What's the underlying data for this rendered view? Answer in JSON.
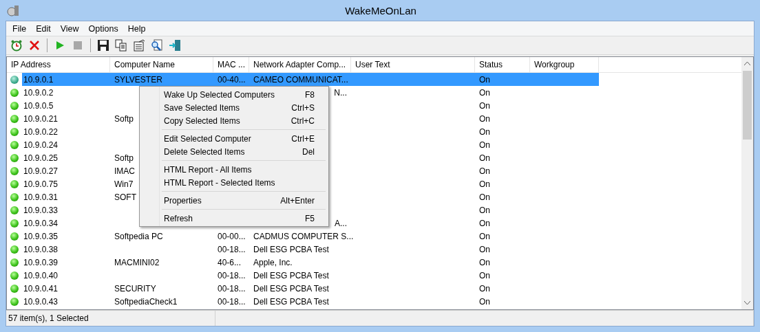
{
  "window": {
    "title": "WakeMeOnLan"
  },
  "menu_bar": [
    "File",
    "Edit",
    "View",
    "Options",
    "Help"
  ],
  "toolbar": [
    {
      "kind": "alarm"
    },
    {
      "kind": "delete"
    },
    {
      "kind": "separator"
    },
    {
      "kind": "play"
    },
    {
      "kind": "stop",
      "disabled": true
    },
    {
      "kind": "separator"
    },
    {
      "kind": "save"
    },
    {
      "kind": "copy"
    },
    {
      "kind": "properties"
    },
    {
      "kind": "find"
    },
    {
      "kind": "exit"
    }
  ],
  "table": {
    "columns": [
      "IP Address",
      "Computer Name",
      "MAC ...",
      "Network Adapter Comp...",
      "User Text",
      "Status",
      "Workgroup"
    ],
    "rows": [
      {
        "ip": "10.9.0.1",
        "computer": "SYLVESTER",
        "mac": "00-40...",
        "adapter": "CAMEO COMMUNICAT...",
        "status": "On",
        "selected": true
      },
      {
        "ip": "10.9.0.2",
        "adapter": "N...",
        "status": "On",
        "selected": false,
        "covered": true
      },
      {
        "ip": "10.9.0.5",
        "status": "On",
        "selected": false
      },
      {
        "ip": "10.9.0.21",
        "computer": "Softp",
        "status": "On",
        "selected": false
      },
      {
        "ip": "10.9.0.22",
        "status": "On",
        "selected": false
      },
      {
        "ip": "10.9.0.24",
        "status": "On",
        "selected": false
      },
      {
        "ip": "10.9.0.25",
        "computer": "Softp",
        "status": "On",
        "selected": false
      },
      {
        "ip": "10.9.0.27",
        "computer": "IMAC",
        "status": "On",
        "selected": false
      },
      {
        "ip": "10.9.0.75",
        "computer": "Win7",
        "status": "On",
        "selected": false
      },
      {
        "ip": "10.9.0.31",
        "computer": "SOFT",
        "status": "On",
        "selected": false
      },
      {
        "ip": "10.9.0.33",
        "status": "On",
        "selected": false
      },
      {
        "ip": "10.9.0.34",
        "adapter": "A...",
        "status": "On",
        "selected": false,
        "covered": true
      },
      {
        "ip": "10.9.0.35",
        "computer": "Softpedia PC",
        "mac": "00-00...",
        "adapter": "CADMUS COMPUTER S...",
        "status": "On",
        "selected": false
      },
      {
        "ip": "10.9.0.38",
        "mac": "00-18...",
        "adapter": "Dell ESG PCBA Test",
        "status": "On",
        "selected": false
      },
      {
        "ip": "10.9.0.39",
        "computer": "MACMINI02",
        "mac": "40-6...",
        "adapter": "Apple, Inc.",
        "status": "On",
        "selected": false
      },
      {
        "ip": "10.9.0.40",
        "mac": "00-18...",
        "adapter": "Dell ESG PCBA Test",
        "status": "On",
        "selected": false
      },
      {
        "ip": "10.9.0.41",
        "computer": "SECURITY",
        "mac": "00-18...",
        "adapter": "Dell ESG PCBA Test",
        "status": "On",
        "selected": false
      },
      {
        "ip": "10.9.0.43",
        "computer": "SoftpediaCheck1",
        "mac": "00-18...",
        "adapter": "Dell ESG PCBA Test",
        "status": "On",
        "selected": false
      }
    ]
  },
  "context_menu": [
    {
      "kind": "item",
      "label": "Wake Up Selected Computers",
      "shortcut": "F8"
    },
    {
      "kind": "item",
      "label": "Save Selected Items",
      "shortcut": "Ctrl+S"
    },
    {
      "kind": "item",
      "label": "Copy Selected Items",
      "shortcut": "Ctrl+C"
    },
    {
      "kind": "separator"
    },
    {
      "kind": "item",
      "label": "Edit Selected Computer",
      "shortcut": "Ctrl+E"
    },
    {
      "kind": "item",
      "label": "Delete Selected Items",
      "shortcut": "Del"
    },
    {
      "kind": "separator"
    },
    {
      "kind": "item",
      "label": "HTML Report - All Items"
    },
    {
      "kind": "item",
      "label": "HTML Report - Selected Items"
    },
    {
      "kind": "separator"
    },
    {
      "kind": "item",
      "label": "Properties",
      "shortcut": "Alt+Enter"
    },
    {
      "kind": "separator"
    },
    {
      "kind": "item",
      "label": "Refresh",
      "shortcut": "F5"
    }
  ],
  "status_bar": [
    "57 item(s), 1 Selected"
  ]
}
